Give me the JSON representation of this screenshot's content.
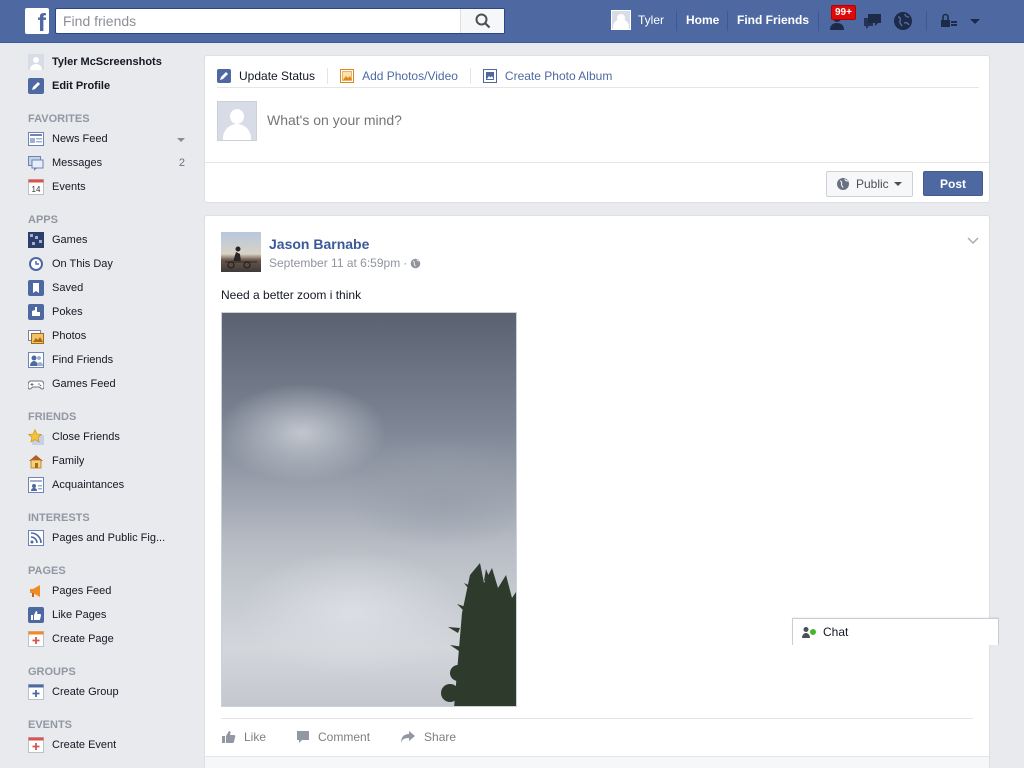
{
  "topbar": {
    "logo": "f",
    "search_placeholder": "Find friends",
    "user_name": "Tyler",
    "home_label": "Home",
    "find_friends_label": "Find Friends",
    "friend_requests_badge": "99+"
  },
  "sidebar": {
    "profile_name": "Tyler McScreenshots",
    "edit_profile": "Edit Profile",
    "sections": {
      "favorites": "FAVORITES",
      "apps": "APPS",
      "friends": "FRIENDS",
      "interests": "INTERESTS",
      "pages": "PAGES",
      "groups": "GROUPS",
      "events": "EVENTS"
    },
    "favorites": [
      {
        "label": "News Feed",
        "icon": "news-feed-icon"
      },
      {
        "label": "Messages",
        "count": "2",
        "icon": "messages-icon"
      },
      {
        "label": "Events",
        "icon": "calendar-icon",
        "icon_text": "14"
      }
    ],
    "apps": [
      {
        "label": "Games",
        "icon": "games-icon"
      },
      {
        "label": "On This Day",
        "icon": "on-this-day-icon"
      },
      {
        "label": "Saved",
        "icon": "saved-icon"
      },
      {
        "label": "Pokes",
        "icon": "pokes-icon"
      },
      {
        "label": "Photos",
        "icon": "photos-icon"
      },
      {
        "label": "Find Friends",
        "icon": "find-friends-icon"
      },
      {
        "label": "Games Feed",
        "icon": "games-feed-icon"
      }
    ],
    "friends": [
      {
        "label": "Close Friends",
        "icon": "star-icon"
      },
      {
        "label": "Family",
        "icon": "house-icon"
      },
      {
        "label": "Acquaintances",
        "icon": "acquaintances-icon"
      }
    ],
    "interests": [
      {
        "label": "Pages and Public Fig...",
        "icon": "rss-icon"
      }
    ],
    "pages": [
      {
        "label": "Pages Feed",
        "icon": "megaphone-icon"
      },
      {
        "label": "Like Pages",
        "icon": "thumbs-up-icon"
      },
      {
        "label": "Create Page",
        "icon": "create-page-icon"
      }
    ],
    "groups": [
      {
        "label": "Create Group",
        "icon": "create-group-icon"
      }
    ],
    "events": [
      {
        "label": "Create Event",
        "icon": "create-event-icon"
      }
    ]
  },
  "composer": {
    "tabs": [
      {
        "label": "Update Status",
        "icon": "pencil-icon"
      },
      {
        "label": "Add Photos/Video",
        "icon": "photo-icon"
      },
      {
        "label": "Create Photo Album",
        "icon": "album-icon"
      }
    ],
    "placeholder": "What's on your mind?",
    "audience_label": "Public",
    "post_label": "Post"
  },
  "story": {
    "author": "Jason Barnabe",
    "timestamp": "September 11 at 6:59pm",
    "meta_separator": "·",
    "text": "Need a better zoom i think",
    "actions": [
      {
        "label": "Like",
        "icon": "like-icon"
      },
      {
        "label": "Comment",
        "icon": "comment-icon"
      },
      {
        "label": "Share",
        "icon": "share-icon"
      }
    ]
  },
  "chat": {
    "label": "Chat"
  },
  "colors": {
    "brand_blue": "#4e69a2",
    "link_blue": "#3b5998",
    "badge_red": "#dc0a0a",
    "background": "#e9eaed"
  }
}
